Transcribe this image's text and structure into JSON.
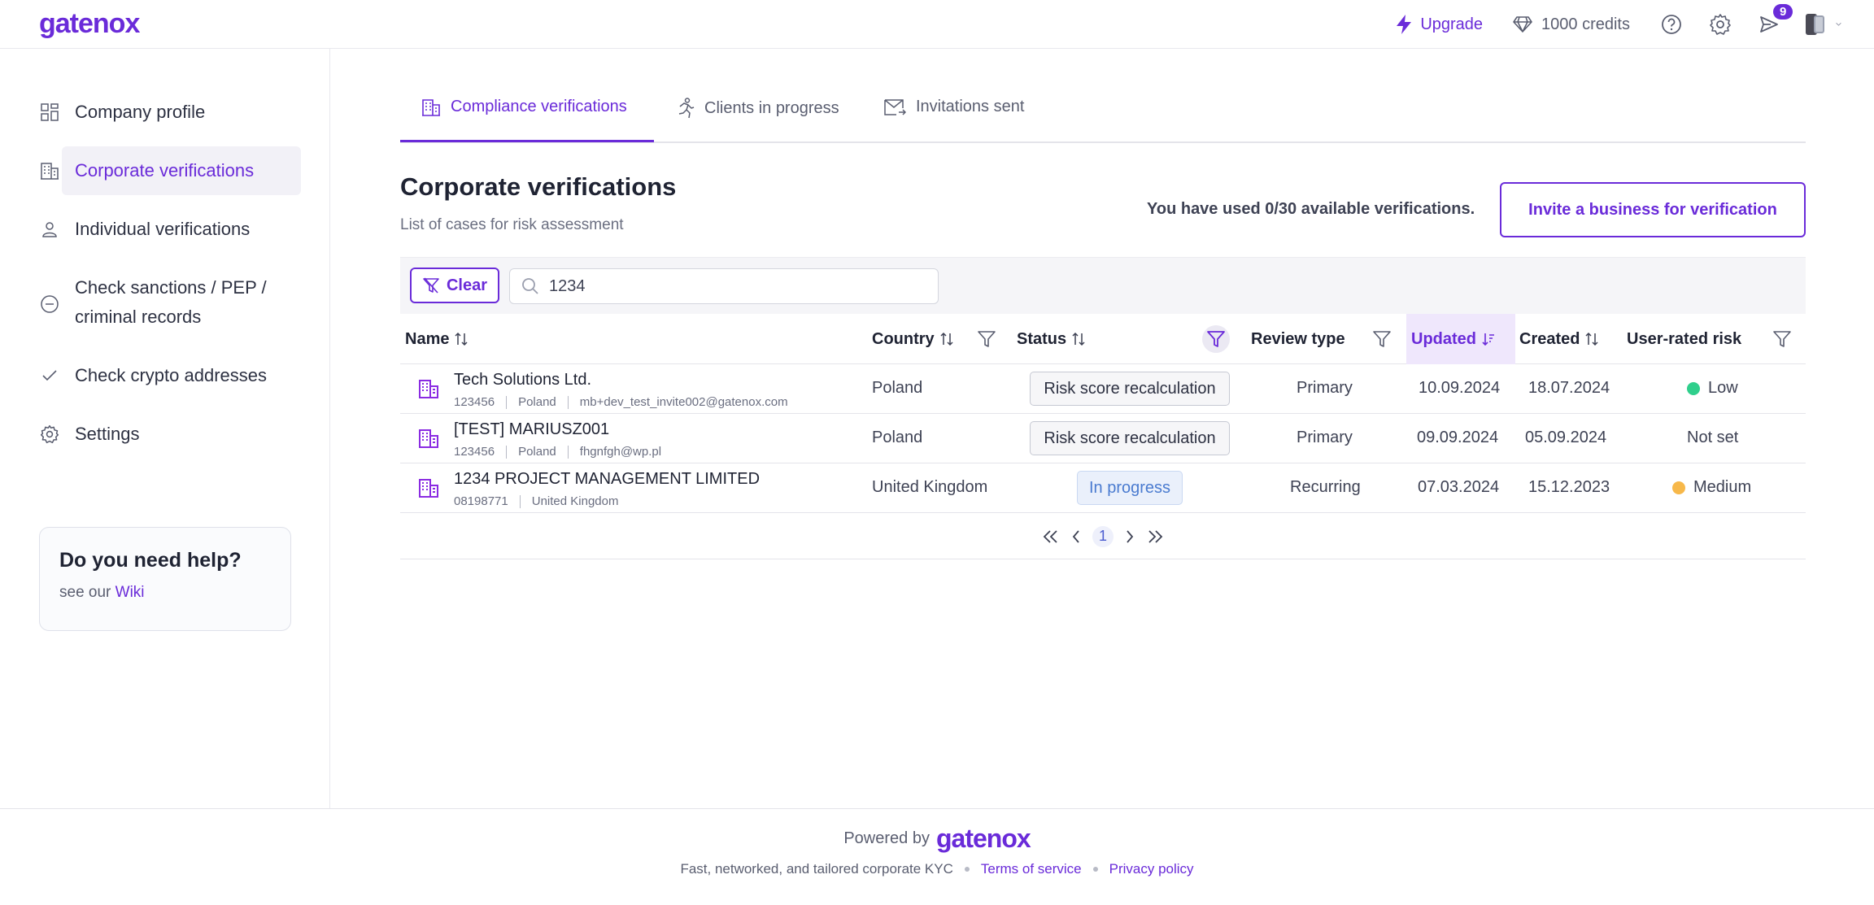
{
  "app": {
    "logo": "gatenox"
  },
  "topbar": {
    "upgrade_label": "Upgrade",
    "credits_label": "1000 credits",
    "notifications_count": "9"
  },
  "sidebar": {
    "items": [
      {
        "label": "Company profile",
        "icon": "grid-icon"
      },
      {
        "label": "Corporate verifications",
        "icon": "building-icon",
        "active": true
      },
      {
        "label": "Individual verifications",
        "icon": "person-icon"
      },
      {
        "label": "Check sanctions / PEP / criminal records",
        "label_line1": "Check sanctions / PEP /",
        "label_line2": "criminal records",
        "icon": "minus-circle-icon"
      },
      {
        "label": "Check crypto addresses",
        "icon": "check-icon"
      },
      {
        "label": "Settings",
        "icon": "gear-icon"
      }
    ],
    "help": {
      "title": "Do you need help?",
      "text": "see our ",
      "link": "Wiki"
    }
  },
  "tabs": [
    {
      "label": "Compliance verifications",
      "active": true
    },
    {
      "label": "Clients in progress"
    },
    {
      "label": "Invitations sent"
    }
  ],
  "page": {
    "title": "Corporate verifications",
    "subtitle": "List of cases for risk assessment",
    "usage_text": "You have used 0/30 available verifications.",
    "invite_button": "Invite a business for verification"
  },
  "filters": {
    "clear_label": "Clear",
    "search_value": "1234"
  },
  "table": {
    "columns": {
      "name": "Name",
      "country": "Country",
      "status": "Status",
      "review_type": "Review type",
      "updated": "Updated",
      "created": "Created",
      "risk": "User-rated risk"
    },
    "rows": [
      {
        "name": "Tech Solutions Ltd.",
        "meta": [
          "123456",
          "Poland",
          "mb+dev_test_invite002@gatenox.com"
        ],
        "country": "Poland",
        "status": "Risk score recalculation",
        "review_type": "Primary",
        "updated": "10.09.2024",
        "created": "18.07.2024",
        "risk": "Low",
        "risk_color": "#2fcf8c"
      },
      {
        "name": "[TEST] MARIUSZ001",
        "meta": [
          "123456",
          "Poland",
          "fhgnfgh@wp.pl"
        ],
        "country": "Poland",
        "status": "Risk score recalculation",
        "review_type": "Primary",
        "updated": "09.09.2024",
        "created": "05.09.2024",
        "risk": "Not set",
        "risk_color": ""
      },
      {
        "name": "1234 PROJECT MANAGEMENT LIMITED",
        "meta": [
          "08198771",
          "United Kingdom"
        ],
        "country": "United Kingdom",
        "status": "In progress",
        "review_type": "Recurring",
        "updated": "07.03.2024",
        "created": "15.12.2023",
        "risk": "Medium",
        "risk_color": "#f7b84a"
      }
    ]
  },
  "pagination": {
    "current_page": "1"
  },
  "footer": {
    "powered_by": "Powered by",
    "logo": "gatenox",
    "tagline": "Fast, networked, and tailored corporate KYC",
    "terms": "Terms of service",
    "privacy": "Privacy policy"
  },
  "colors": {
    "accent": "#6a2bd9",
    "low": "#2fcf8c",
    "medium": "#f7b84a"
  }
}
